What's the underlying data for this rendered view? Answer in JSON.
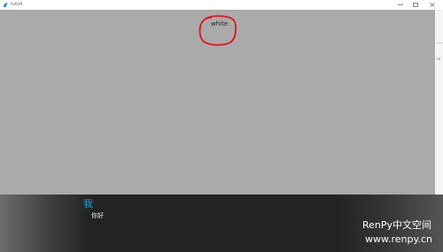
{
  "window": {
    "title": "tuto4",
    "icon": "renpy-icon"
  },
  "scene": {
    "text": "white"
  },
  "dialogue": {
    "speaker": "我",
    "text": "你好"
  },
  "watermark": {
    "line1": "RenPy中文空间",
    "line2": "www.renpy.cn"
  },
  "colors": {
    "scene_background": "#aaaaaa",
    "speaker_name": "#1aa3d6",
    "annotation_circle": "#e8101e"
  }
}
